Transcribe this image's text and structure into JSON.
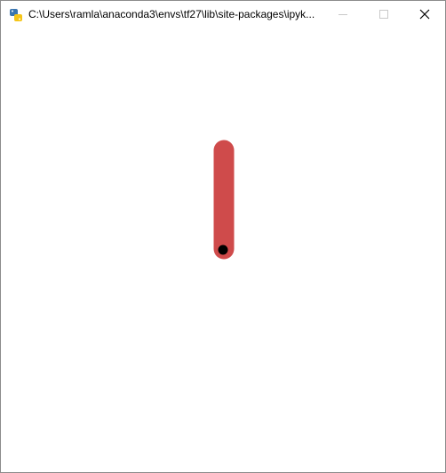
{
  "window": {
    "title": "C:\\Users\\ramla\\anaconda3\\envs\\tf27\\lib\\site-packages\\ipyk...",
    "app_icon": "python-icon",
    "controls": {
      "minimize_icon": "minimize-icon",
      "maximize_icon": "maximize-icon",
      "close_icon": "close-icon"
    }
  },
  "scene": {
    "pole_color": "#cf4b4b",
    "axle_color": "#000000",
    "background_color": "#ffffff"
  }
}
